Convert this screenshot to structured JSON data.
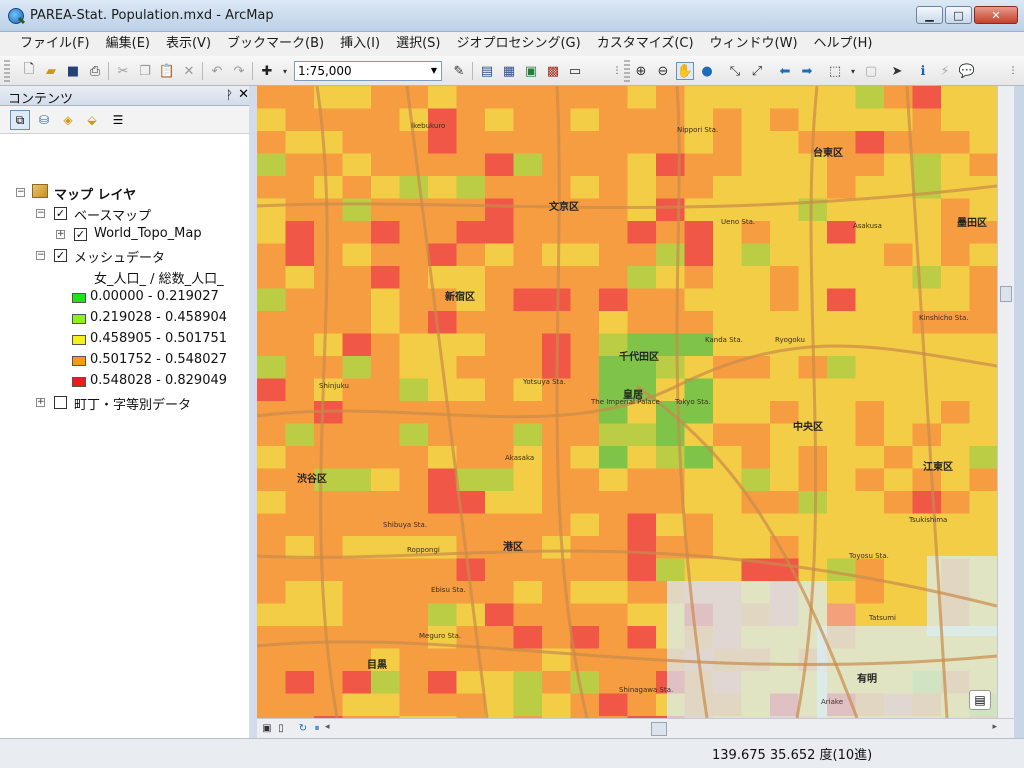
{
  "window": {
    "title": "PAREA-Stat. Population.mxd - ArcMap",
    "minimize": "▁",
    "maximize": "□",
    "close": "✕"
  },
  "menu": [
    "ファイル(F)",
    "編集(E)",
    "表示(V)",
    "ブックマーク(B)",
    "挿入(I)",
    "選択(S)",
    "ジオプロセシング(G)",
    "カスタマイズ(C)",
    "ウィンドウ(W)",
    "ヘルプ(H)"
  ],
  "toolbar": {
    "scale": "1:75,000"
  },
  "toc": {
    "title": "コンテンツ",
    "pin": "ᚹ",
    "close": "✕",
    "root": "マップ レイヤ",
    "basemap_group": "ベースマップ",
    "basemap_layer": "World_Topo_Map",
    "mesh_layer": "メッシュデータ",
    "mesh_field": "女_人口_ / 総数_人口_",
    "legend": [
      {
        "label": "0.00000 - 0.219027",
        "color": "#1fe21f"
      },
      {
        "label": "0.219028 - 0.458904",
        "color": "#8df21a"
      },
      {
        "label": "0.458905 - 0.501751",
        "color": "#f2f21a"
      },
      {
        "label": "0.501752 - 0.548027",
        "color": "#f79a14"
      },
      {
        "label": "0.548028 - 0.829049",
        "color": "#ec1c1c"
      }
    ],
    "town_layer": "町丁・字等別データ"
  },
  "map": {
    "labels": [
      {
        "text": "文京区",
        "cls": "big"
      },
      {
        "text": "新宿区",
        "cls": "big"
      },
      {
        "text": "千代田区",
        "cls": "big"
      },
      {
        "text": "台東区",
        "cls": "big"
      },
      {
        "text": "墨田区",
        "cls": "big"
      },
      {
        "text": "渋谷区",
        "cls": "big"
      },
      {
        "text": "港区",
        "cls": "big"
      },
      {
        "text": "中央区",
        "cls": "big"
      },
      {
        "text": "江東区",
        "cls": "big"
      },
      {
        "text": "目黒",
        "cls": "big"
      },
      {
        "text": "有明",
        "cls": "big"
      },
      {
        "text": "皇居",
        "cls": "big"
      },
      {
        "text": "The Imperial Palace",
        "cls": "sta"
      },
      {
        "text": "Shinjuku",
        "cls": "sta"
      },
      {
        "text": "Shibuya Sta.",
        "cls": "sta"
      },
      {
        "text": "Ikebukuro",
        "cls": "sta"
      },
      {
        "text": "Tokyo Sta.",
        "cls": "sta"
      },
      {
        "text": "Akasaka",
        "cls": "sta"
      },
      {
        "text": "Ebisu Sta.",
        "cls": "sta"
      },
      {
        "text": "Meguro Sta.",
        "cls": "sta"
      },
      {
        "text": "Shinagawa Sta.",
        "cls": "sta"
      },
      {
        "text": "Ueno Sta.",
        "cls": "sta"
      },
      {
        "text": "Asakusa",
        "cls": "sta"
      },
      {
        "text": "Kinshicho Sta.",
        "cls": "sta"
      },
      {
        "text": "Nippori Sta.",
        "cls": "sta"
      },
      {
        "text": "Roppongi",
        "cls": "sta"
      },
      {
        "text": "Ariake",
        "cls": "sta"
      },
      {
        "text": "Toyosu Sta.",
        "cls": "sta"
      },
      {
        "text": "Tsukishima",
        "cls": "sta"
      },
      {
        "text": "Yotsuya Sta.",
        "cls": "sta"
      },
      {
        "text": "Kanda Sta.",
        "cls": "sta"
      },
      {
        "text": "Ryogoku",
        "cls": "sta"
      },
      {
        "text": "Tatsumi",
        "cls": "sta"
      }
    ]
  },
  "status": {
    "coords": "139.675  35.652 度(10進)"
  }
}
